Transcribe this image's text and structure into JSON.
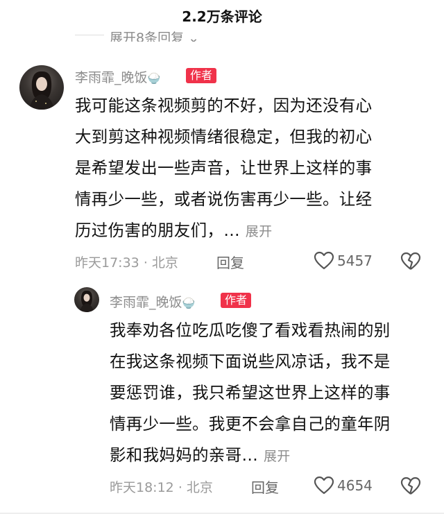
{
  "header": {
    "title": "2.2万条评论"
  },
  "collapsed": {
    "label": "展开8条回复"
  },
  "comments": [
    {
      "username": "李雨霏_晚饭",
      "badge": "作者",
      "text": "我可能这条视频剪的不好，因为还没有心\n大到剪这种视频情绪很稳定，但我的初心\n是希望发出一些声音，让世界上这样的事\n情再少一些，或者说伤害再少一些。让经\n历过伤害的朋友们，…",
      "expand": "展开",
      "time": "昨天17:33",
      "separator": "·",
      "location": "北京",
      "reply": "回复",
      "likes": "5457"
    },
    {
      "username": "李雨霏_晚饭",
      "badge": "作者",
      "text": "我奉劝各位吃瓜吃傻了看戏看热闹的别\n在我这条视频下面说些风凉话，我不是\n要惩罚谁，我只希望这世界上这样的事\n情再少一些。我更不会拿自己的童年阴\n影和我妈妈的亲哥…",
      "expand": "展开",
      "time": "昨天18:12",
      "separator": "·",
      "location": "北京",
      "reply": "回复",
      "likes": "4654"
    }
  ],
  "icons": {
    "bowl": "🍚",
    "chevron": "chevron-down-icon",
    "heart": "heart-outline-icon",
    "dislike": "broken-heart-icon"
  }
}
